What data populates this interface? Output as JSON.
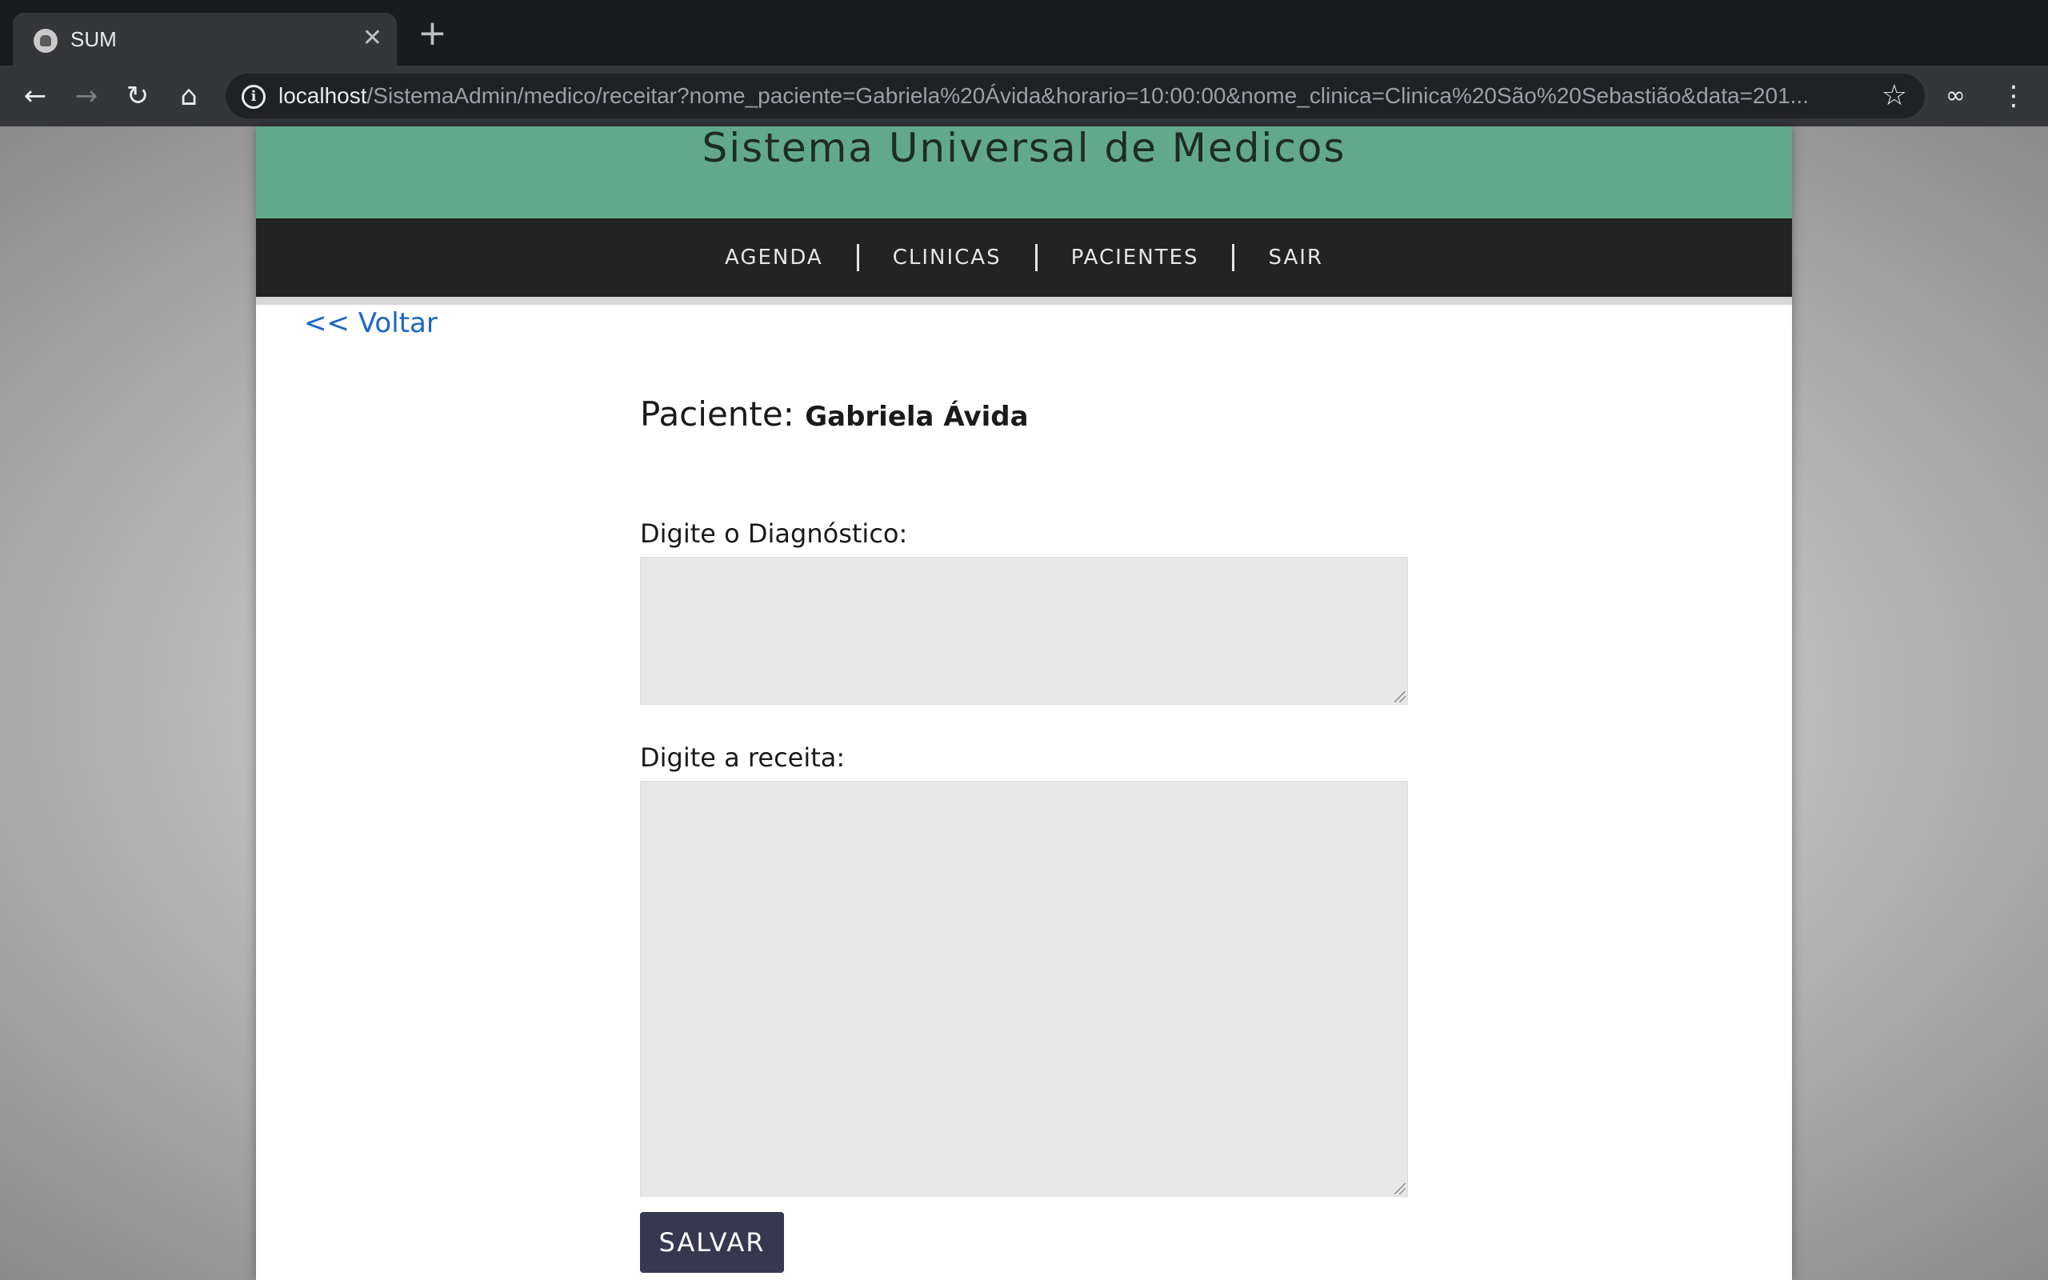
{
  "browser": {
    "tab_title": "SUM",
    "tab_close": "✕",
    "new_tab": "+",
    "url_host": "localhost",
    "url_path": "/SistemaAdmin/medico/receitar?nome_paciente=Gabriela%20Ávida&horario=10:00:00&nome_clinica=Clinica%20São%20Sebastião&data=201..."
  },
  "header": {
    "title": "Sistema Universal de Medicos"
  },
  "nav": {
    "items": [
      "AGENDA",
      "CLINICAS",
      "PACIENTES",
      "SAIR"
    ]
  },
  "main": {
    "back_link": "<< Voltar",
    "patient_label": "Paciente:",
    "patient_name": "Gabriela Ávida",
    "diagnosis_label": "Digite o Diagnóstico:",
    "prescription_label": "Digite a receita:",
    "save_label": "SALVAR"
  },
  "colors": {
    "header_bg": "#62a98b",
    "nav_bg": "#232323",
    "link": "#1a66c9",
    "button_bg": "#363850"
  }
}
